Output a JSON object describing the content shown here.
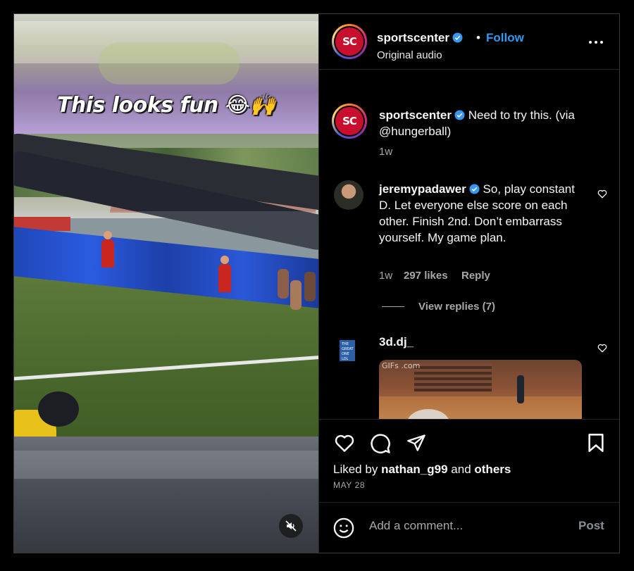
{
  "post": {
    "media": {
      "caption_overlay": "This looks fun 😂🙌",
      "mute_icon": "muted-speaker-icon",
      "gif_watermark": "GIFs .com"
    },
    "header": {
      "username": "sportscenter",
      "dot": "•",
      "follow_label": "Follow",
      "audio_label": "Original audio",
      "avatar_text": "SC"
    },
    "caption": {
      "username": "sportscenter",
      "text": "Need to try this. (via @hungerball)",
      "time": "1w"
    },
    "comments": [
      {
        "username": "jeremypadawer",
        "text": "So, play constant D. Let everyone else score on each other. Finish 2nd. Don’t embarrass yourself. My game plan.",
        "time": "1w",
        "likes": "297 likes",
        "reply_label": "Reply",
        "view_replies": "View replies (7)"
      },
      {
        "username": "3d.dj_"
      }
    ],
    "liked_by": {
      "prefix": "Liked by",
      "user": "nathan_g99",
      "and": "and",
      "others": "others"
    },
    "date": "MAY 28",
    "add_comment": {
      "placeholder": "Add a comment...",
      "post_label": "Post"
    },
    "colors": {
      "accent": "#2f9bf0",
      "verified": "#3897f0",
      "brand_red": "#c8102e"
    }
  }
}
